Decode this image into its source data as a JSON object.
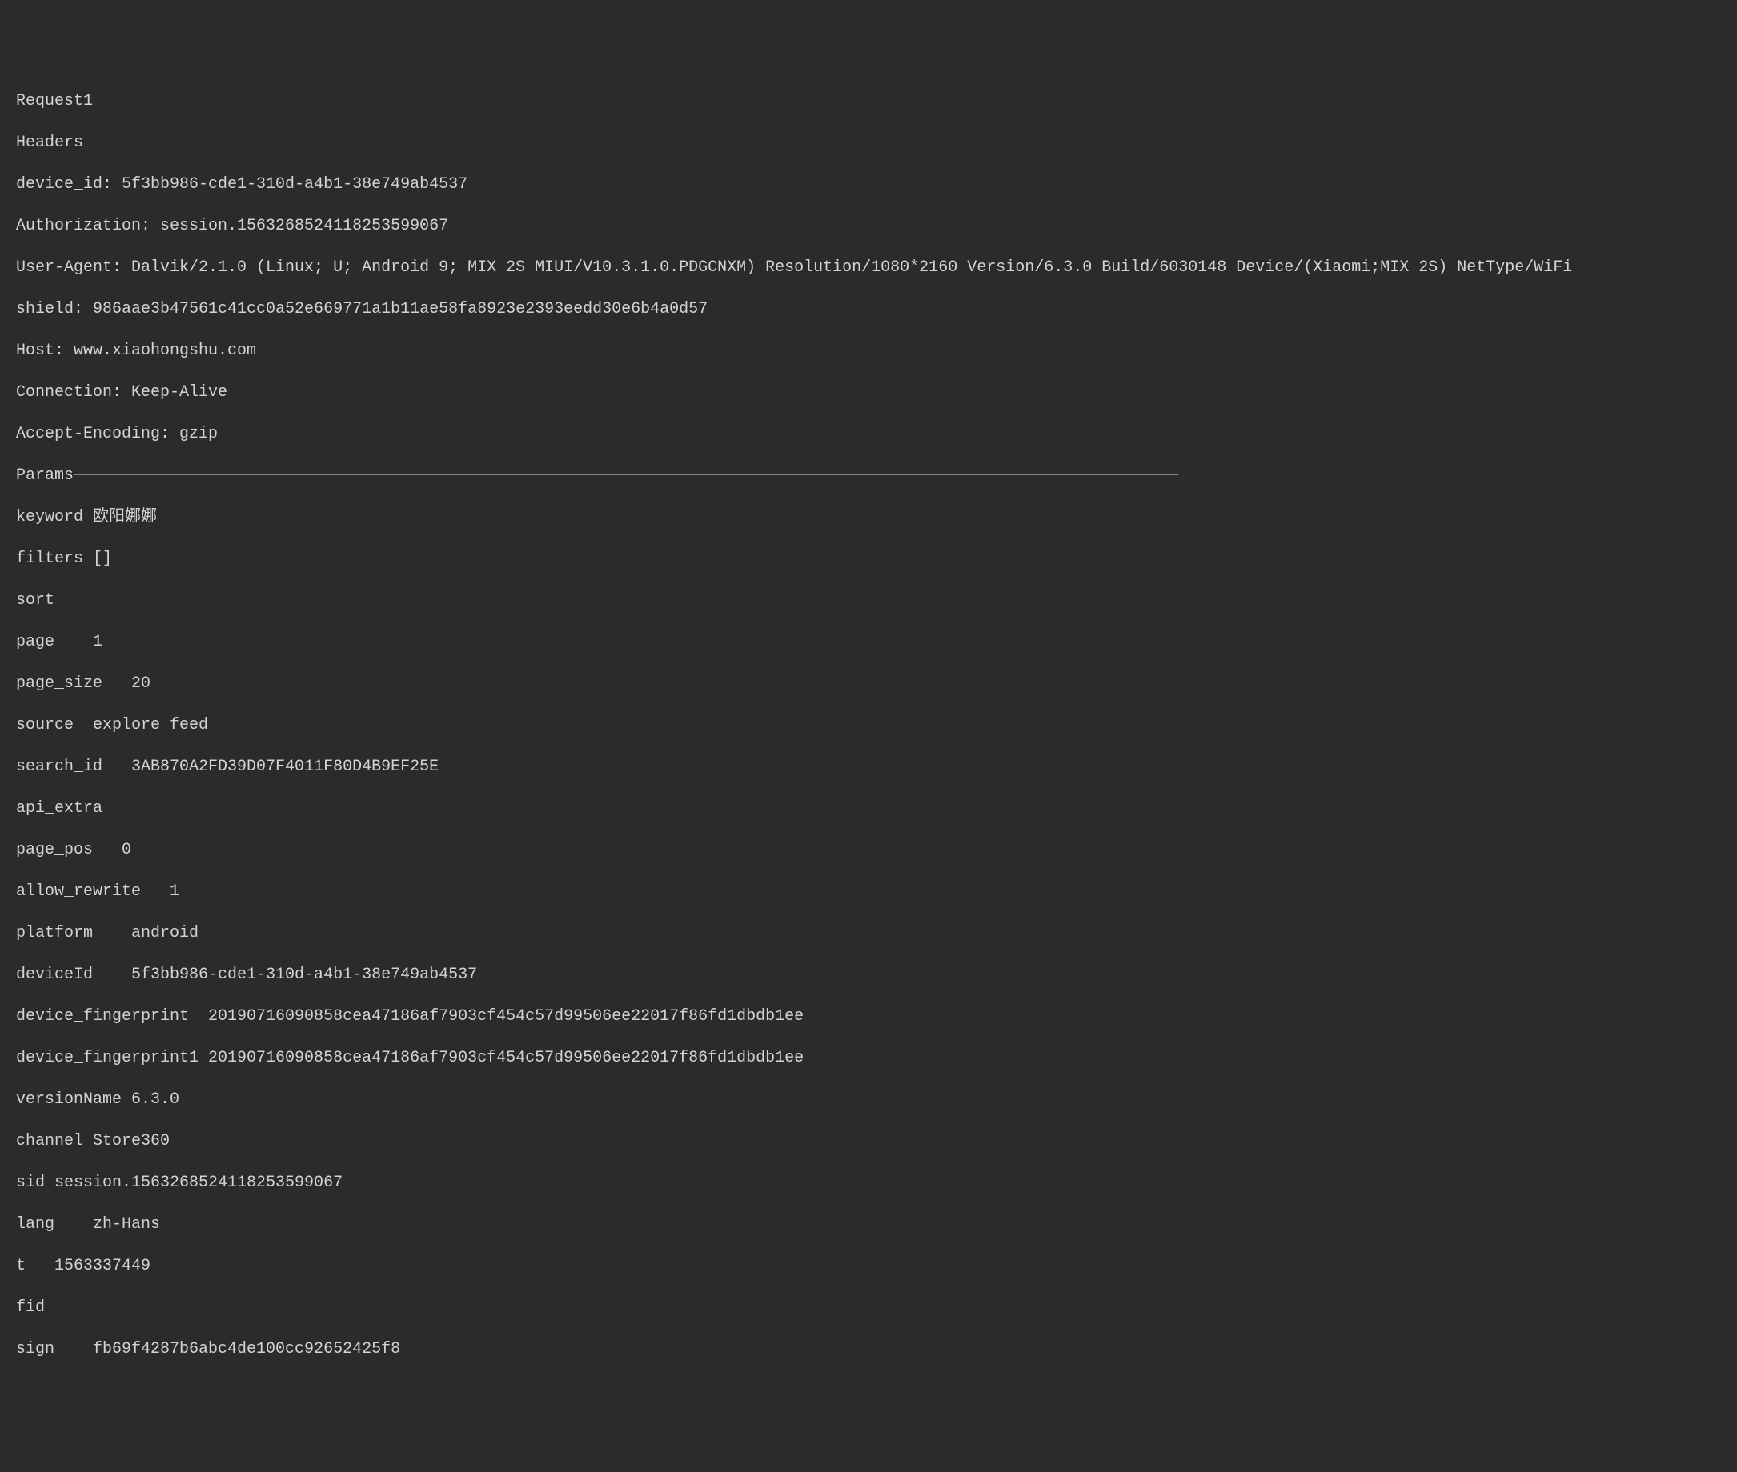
{
  "title": "Request1",
  "headers_label": "Headers",
  "headers": {
    "device_id": "device_id: 5f3bb986-cde1-310d-a4b1-38e749ab4537",
    "authorization": "Authorization: session.1563268524118253599067",
    "user_agent": "User-Agent: Dalvik/2.1.0 (Linux; U; Android 9; MIX 2S MIUI/V10.3.1.0.PDGCNXM) Resolution/1080*2160 Version/6.3.0 Build/6030148 Device/(Xiaomi;MIX 2S) NetType/WiFi",
    "shield": "shield: 986aae3b47561c41cc0a52e669771a1b11ae58fa8923e2393eedd30e6b4a0d57",
    "host": "Host: www.xiaohongshu.com",
    "connection": "Connection: Keep-Alive",
    "accept_encoding": "Accept-Encoding: gzip"
  },
  "params_label": "Params───────────────────────────────────────────────────────────────────────────────────────────────────────────────────",
  "params": {
    "keyword": "keyword 欧阳娜娜",
    "filters": "filters []",
    "sort": "sort",
    "page": "page    1",
    "page_size": "page_size   20",
    "source": "source  explore_feed",
    "search_id": "search_id   3AB870A2FD39D07F4011F80D4B9EF25E",
    "api_extra": "api_extra",
    "page_pos": "page_pos   0",
    "allow_rewrite": "allow_rewrite   1",
    "platform": "platform    android",
    "deviceId": "deviceId    5f3bb986-cde1-310d-a4b1-38e749ab4537",
    "device_fingerprint": "device_fingerprint  20190716090858cea47186af7903cf454c57d99506ee22017f86fd1dbdb1ee",
    "device_fingerprint1": "device_fingerprint1 20190716090858cea47186af7903cf454c57d99506ee22017f86fd1dbdb1ee",
    "versionName": "versionName 6.3.0",
    "channel": "channel Store360",
    "sid": "sid session.1563268524118253599067",
    "lang": "lang    zh-Hans",
    "t": "t   1563337449",
    "fid": "fid",
    "sign": "sign    fb69f4287b6abc4de100cc92652425f8"
  }
}
